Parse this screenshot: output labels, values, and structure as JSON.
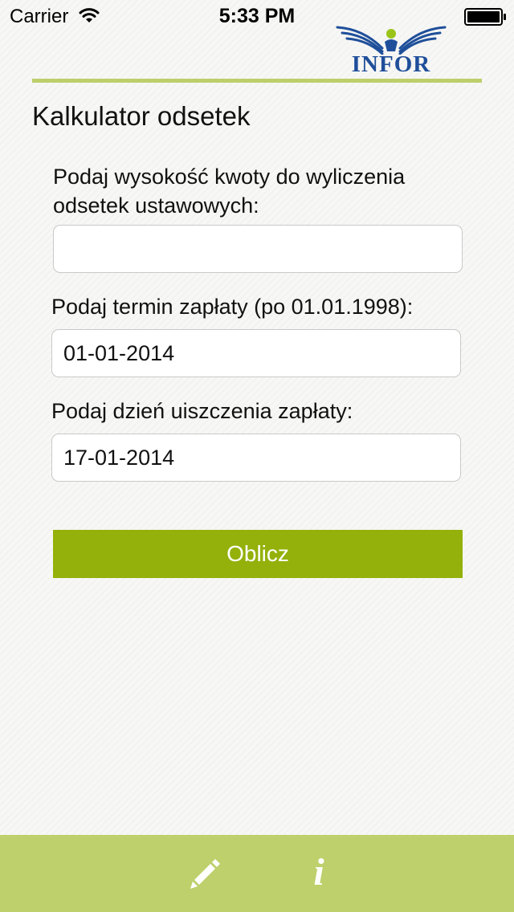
{
  "status_bar": {
    "carrier": "Carrier",
    "time": "5:33 PM",
    "wifi_icon": "wifi-icon",
    "battery_icon": "battery-full-icon"
  },
  "header": {
    "logo_text": "INFOR",
    "brand_color": "#1f4f9a",
    "rule_color": "#bccf6b"
  },
  "page": {
    "title": "Kalkulator odsetek"
  },
  "form": {
    "amount": {
      "label": "Podaj wysokość kwoty do wyliczenia odsetek ustawowych:",
      "value": ""
    },
    "due_date": {
      "label": "Podaj termin zapłaty (po 01.01.1998):",
      "value": "01-01-2014"
    },
    "payment_date": {
      "label": "Podaj dzień uiszczenia zapłaty:",
      "value": "17-01-2014"
    },
    "submit_label": "Oblicz",
    "submit_color": "#93b10a"
  },
  "tab_bar": {
    "background": "#bdd06c",
    "items": [
      {
        "icon": "pencil-icon"
      },
      {
        "icon": "info-icon",
        "glyph": "i"
      }
    ]
  }
}
